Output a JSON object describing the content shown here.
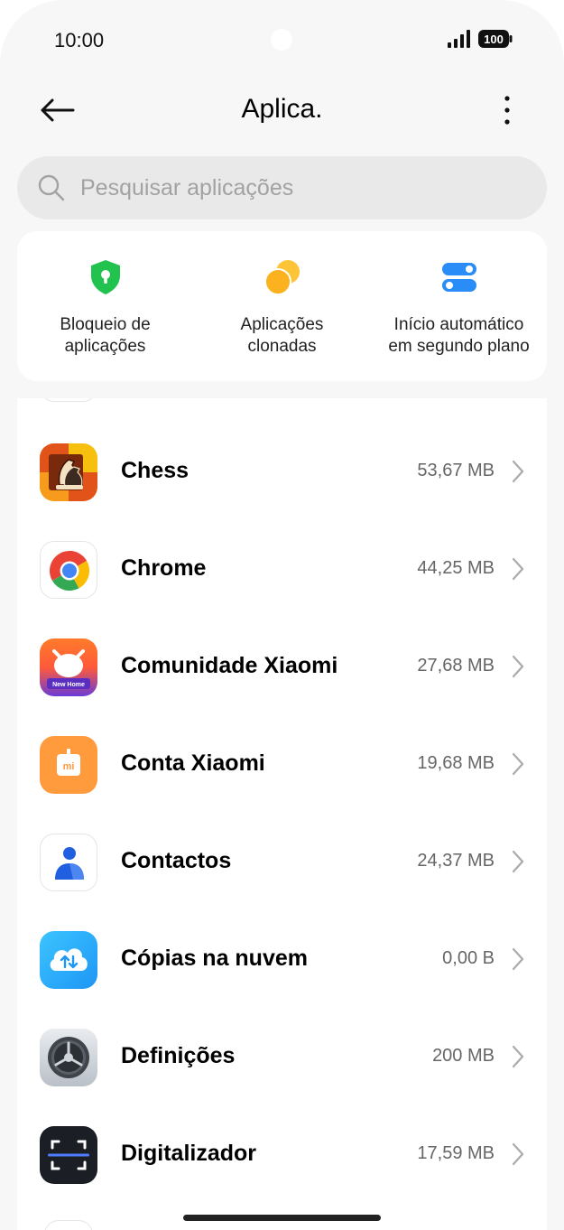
{
  "status_bar": {
    "time": "10:00",
    "battery": "100"
  },
  "header": {
    "title": "Aplica."
  },
  "search": {
    "placeholder": "Pesquisar aplicações"
  },
  "shortcuts": [
    {
      "label": "Bloqueio de\naplicações",
      "icon": "shield-lock-icon",
      "color": "#22c24e"
    },
    {
      "label": "Aplicações\nclonadas",
      "icon": "clone-circles-icon",
      "color": "#fbb21e"
    },
    {
      "label": "Início automático\nem segundo plano",
      "icon": "toggles-icon",
      "color": "#2a8cf6"
    }
  ],
  "apps": [
    {
      "name": "Chess",
      "size": "53,67 MB",
      "icon": "chess-icon"
    },
    {
      "name": "Chrome",
      "size": "44,25 MB",
      "icon": "chrome-icon"
    },
    {
      "name": "Comunidade Xiaomi",
      "size": "27,68 MB",
      "icon": "xiaomi-community-icon",
      "icon_text": "New Home"
    },
    {
      "name": "Conta Xiaomi",
      "size": "19,68 MB",
      "icon": "xiaomi-account-icon",
      "icon_text": "mi"
    },
    {
      "name": "Contactos",
      "size": "24,37 MB",
      "icon": "contacts-icon"
    },
    {
      "name": "Cópias na nuvem",
      "size": "0,00 B",
      "icon": "cloud-backup-icon"
    },
    {
      "name": "Definições",
      "size": "200 MB",
      "icon": "settings-gear-icon"
    },
    {
      "name": "Digitalizador",
      "size": "17,59 MB",
      "icon": "scanner-icon"
    }
  ]
}
